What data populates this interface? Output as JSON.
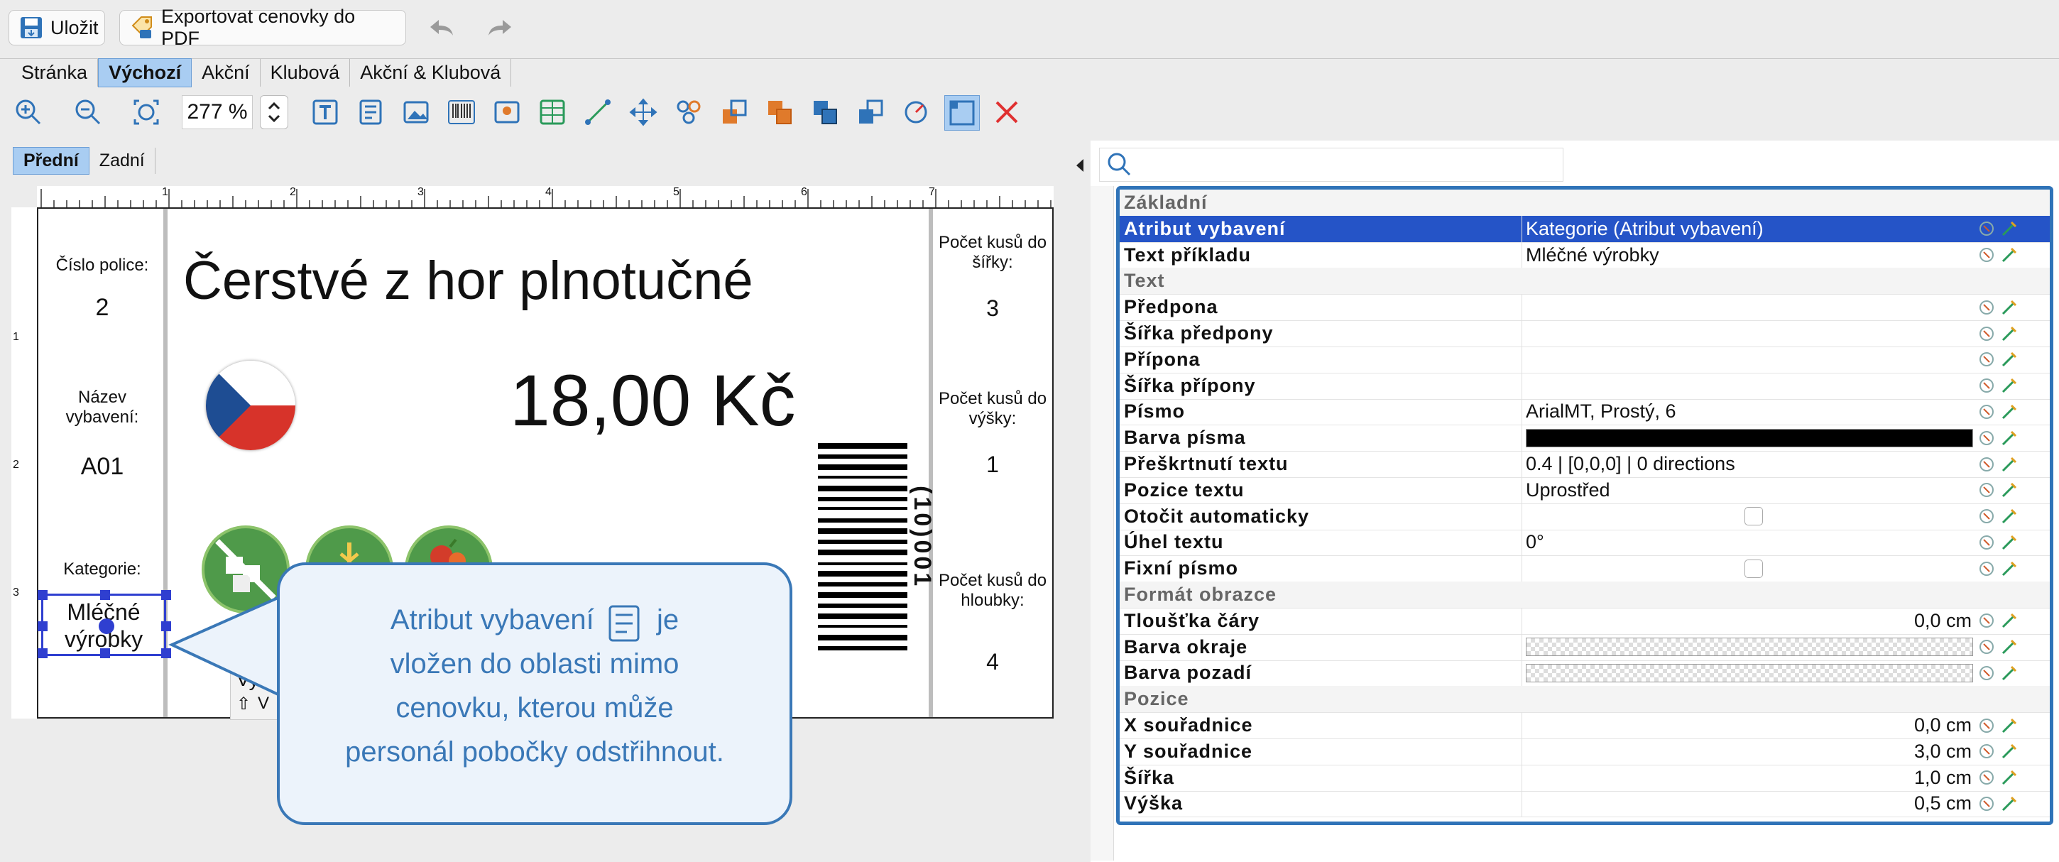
{
  "toolbar": {
    "save_label": "Uložit",
    "export_label": "Exportovat cenovky do PDF"
  },
  "templates": {
    "tabs": [
      "Stránka",
      "Výchozí",
      "Akční",
      "Klubová",
      "Akční & Klubová"
    ],
    "active": "Výchozí"
  },
  "zoom": "277 %",
  "sides": {
    "tabs": [
      "Přední",
      "Zadní"
    ],
    "active": "Přední"
  },
  "ruler": {
    "h_labels": [
      "1",
      "2",
      "3",
      "4",
      "5",
      "6",
      "7"
    ],
    "v_labels": [
      "1",
      "2",
      "3"
    ]
  },
  "label": {
    "shelf_label": "Číslo police:",
    "shelf_value": "2",
    "equip_label": "Název vybavení:",
    "equip_value": "A01",
    "category_label": "Kategorie:",
    "category_value": "Mléčné výrobky",
    "title": "Čerstvé z hor plnotučné",
    "price": "18,00 Kč",
    "barcode_text": "(10)001",
    "width_label": "Počet kusů do šířky:",
    "width_value": "3",
    "height_label": "Počet kusů do výšky:",
    "height_value": "1",
    "depth_label": "Počet kusů do hloubky:",
    "depth_value": "4",
    "popup_text_1": "Vyb",
    "popup_text_2": "V"
  },
  "callout": {
    "line1_a": "Atribut vybavení",
    "line1_b": "je",
    "line2": "vložen do oblasti mimo",
    "line3": "cenovku, kterou může",
    "line4": "personál pobočky odstřihnout."
  },
  "search": {
    "placeholder": ""
  },
  "properties": [
    {
      "name": "Základní",
      "section": true
    },
    {
      "name": "Atribut vybavení",
      "value": "Kategorie (Atribut vybavení)",
      "selected": true
    },
    {
      "name": "Text příkladu",
      "value": "Mléčné výrobky"
    },
    {
      "name": "Text",
      "section": true
    },
    {
      "name": "Předpona",
      "value": ""
    },
    {
      "name": "Šířka předpony",
      "value": ""
    },
    {
      "name": "Přípona",
      "value": ""
    },
    {
      "name": "Šířka přípony",
      "value": ""
    },
    {
      "name": "Písmo",
      "value": "ArialMT, Prostý, 6"
    },
    {
      "name": "Barva písma",
      "value": "",
      "swatch": "#000000"
    },
    {
      "name": "Přeškrtnutí textu",
      "value": "0.4 | [0,0,0] | 0 directions"
    },
    {
      "name": "Pozice textu",
      "value": "Uprostřed"
    },
    {
      "name": "Otočit automaticky",
      "value": "",
      "checkbox": true
    },
    {
      "name": "Úhel textu",
      "value": "0°"
    },
    {
      "name": "Fixní písmo",
      "value": "",
      "checkbox": true
    },
    {
      "name": "Formát obrazce",
      "section": true
    },
    {
      "name": "Tloušťka čáry",
      "value": "0,0 cm",
      "right": true
    },
    {
      "name": "Barva okraje",
      "value": "",
      "swatch": "transparent"
    },
    {
      "name": "Barva pozadí",
      "value": "",
      "swatch": "transparent"
    },
    {
      "name": "Pozice",
      "section": true
    },
    {
      "name": "X souřadnice",
      "value": "0,0 cm",
      "right": true
    },
    {
      "name": "Y souřadnice",
      "value": "3,0 cm",
      "right": true
    },
    {
      "name": "Šířka",
      "value": "1,0 cm",
      "right": true
    },
    {
      "name": "Výška",
      "value": "0,5 cm",
      "right": true
    }
  ],
  "colors": {
    "accent": "#2f73b8",
    "selection": "#2554c7",
    "callout_text": "#3a78b7"
  }
}
